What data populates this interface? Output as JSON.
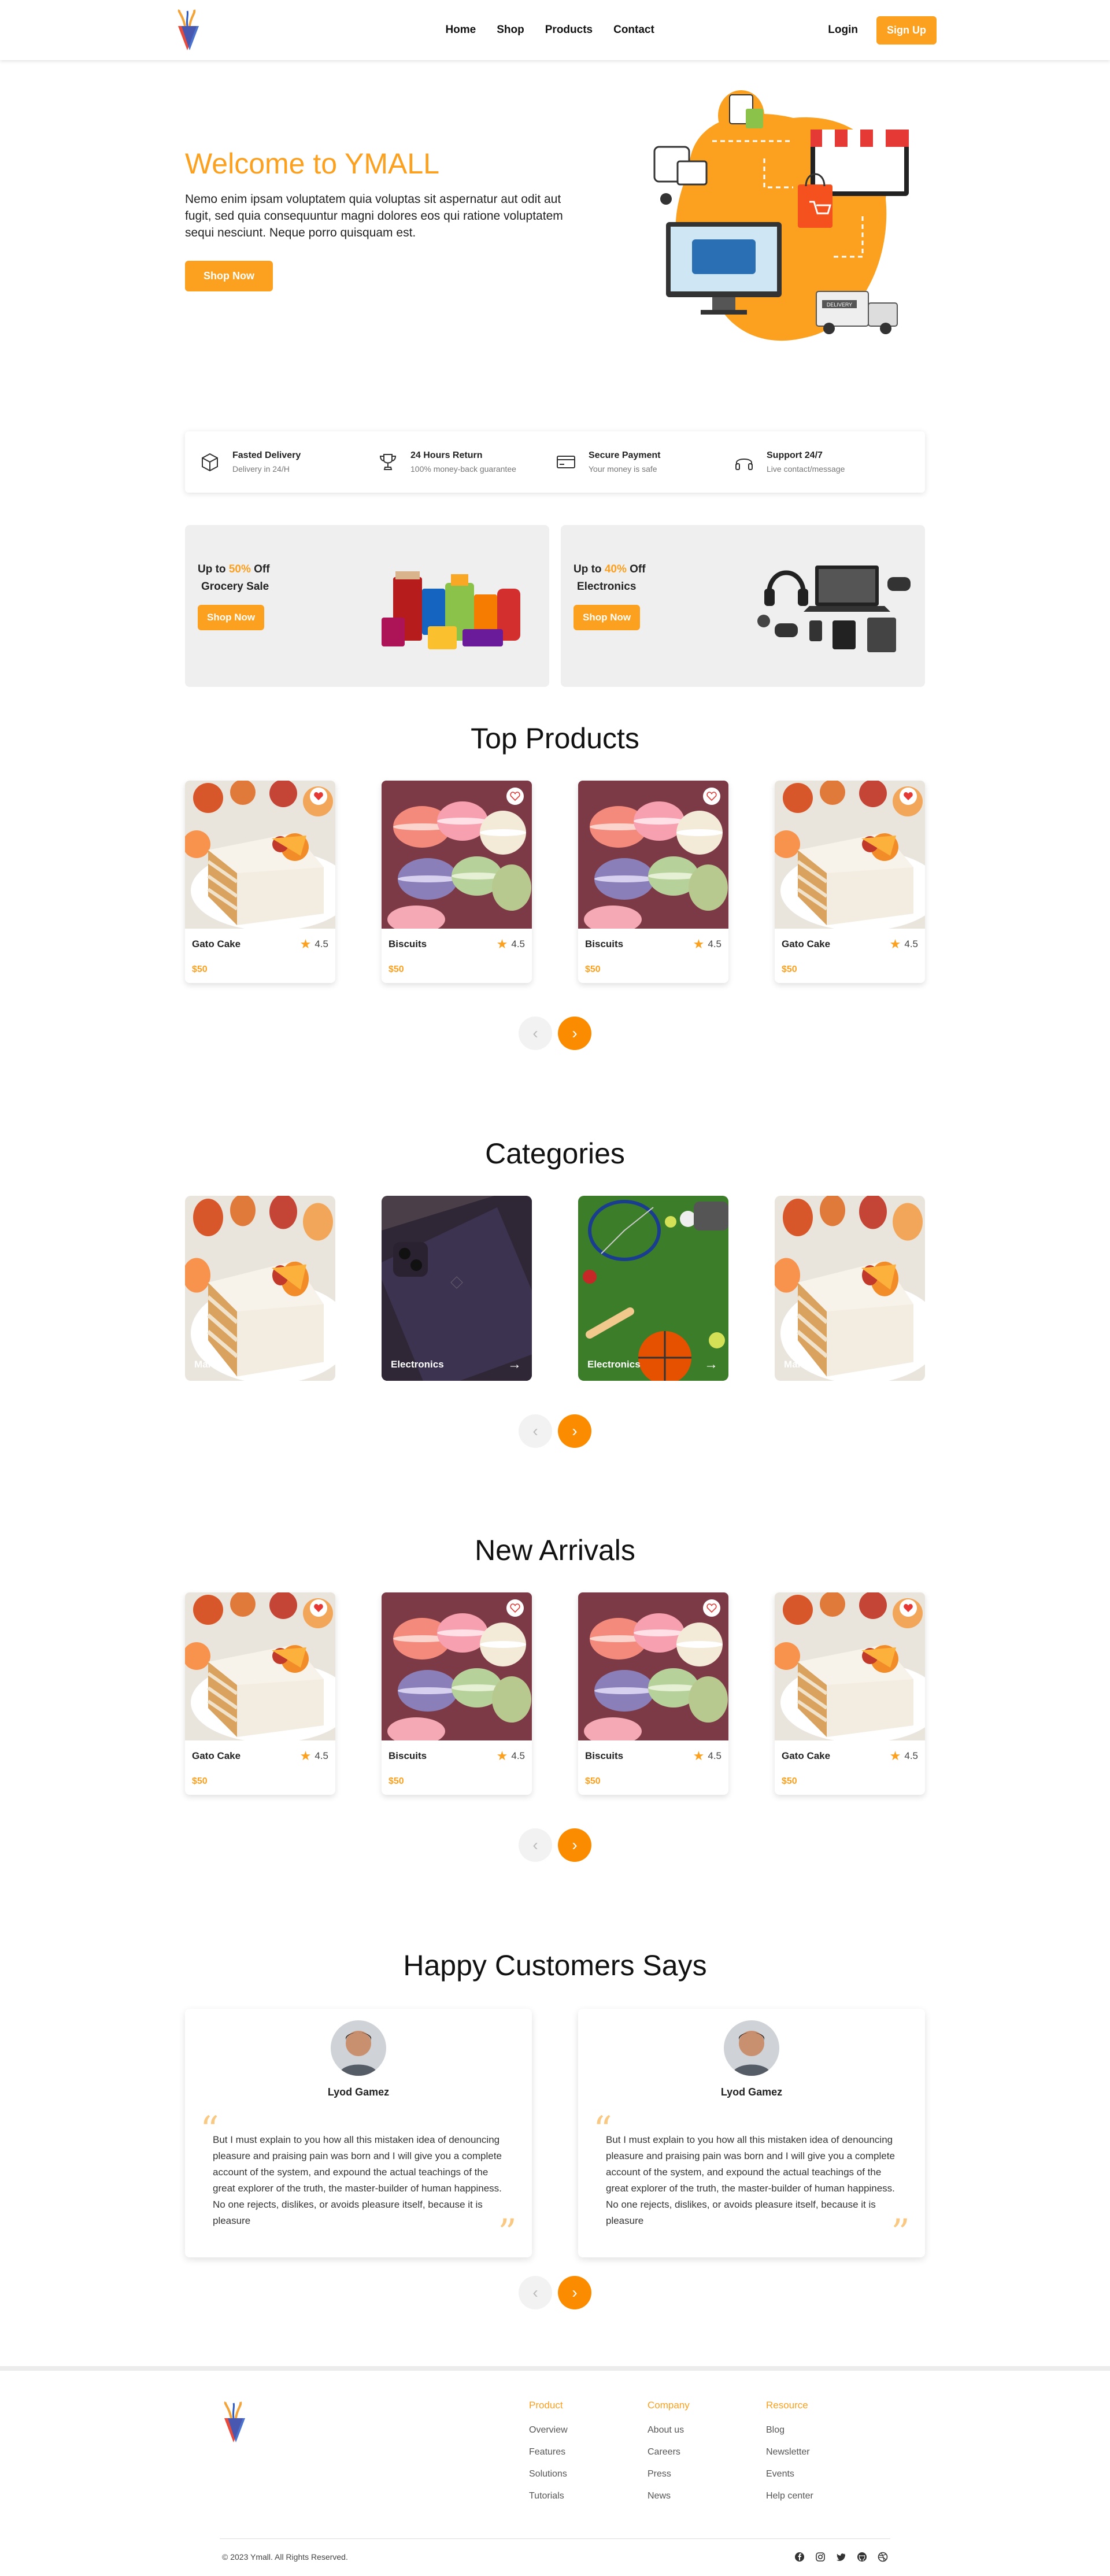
{
  "nav": {
    "links": [
      "Home",
      "Shop",
      "Products",
      "Contact"
    ],
    "login": "Login",
    "signup": "Sign Up"
  },
  "hero": {
    "title": "Welcome to YMALL",
    "description": "Nemo enim ipsam voluptatem quia voluptas sit aspernatur aut odit aut fugit, sed quia consequuntur magni dolores eos qui ratione voluptatem sequi nesciunt. Neque porro quisquam est.",
    "cta": "Shop Now",
    "truck_label": "DELIVERY"
  },
  "features": [
    {
      "title": "Fasted Delivery",
      "sub": "Delivery in 24/H",
      "icon": "box-icon"
    },
    {
      "title": "24 Hours Return",
      "sub": "100% money-back guarantee",
      "icon": "trophy-icon"
    },
    {
      "title": "Secure Payment",
      "sub": "Your money is safe",
      "icon": "credit-card-icon"
    },
    {
      "title": "Support 24/7",
      "sub": "Live contact/message",
      "icon": "headphones-icon"
    }
  ],
  "promos": [
    {
      "prefix": "Up to ",
      "percent": "50%",
      "suffix": " Off",
      "category": "Grocery Sale",
      "cta": "Shop Now"
    },
    {
      "prefix": "Up to ",
      "percent": "40%",
      "suffix": " Off",
      "category": "Electronics",
      "cta": "Shop Now"
    }
  ],
  "top_products": {
    "title": "Top Products",
    "items": [
      {
        "name": "Gato Cake",
        "rating": "4.5",
        "price": "$50",
        "image": "cake",
        "favorited": true
      },
      {
        "name": "Biscuits",
        "rating": "4.5",
        "price": "$50",
        "image": "macarons",
        "favorited": false
      },
      {
        "name": "Biscuits",
        "rating": "4.5",
        "price": "$50",
        "image": "macarons",
        "favorited": false
      },
      {
        "name": "Gato Cake",
        "rating": "4.5",
        "price": "$50",
        "image": "cake",
        "favorited": true
      }
    ]
  },
  "categories": {
    "title": "Categories",
    "items": [
      {
        "label": "Mart",
        "image": "cake"
      },
      {
        "label": "Electronics",
        "image": "phone"
      },
      {
        "label": "Electronics",
        "image": "sports"
      },
      {
        "label": "Mart",
        "image": "cake"
      }
    ]
  },
  "new_arrivals": {
    "title": "New Arrivals",
    "items": [
      {
        "name": "Gato Cake",
        "rating": "4.5",
        "price": "$50",
        "image": "cake",
        "favorited": true
      },
      {
        "name": "Biscuits",
        "rating": "4.5",
        "price": "$50",
        "image": "macarons",
        "favorited": false
      },
      {
        "name": "Biscuits",
        "rating": "4.5",
        "price": "$50",
        "image": "macarons",
        "favorited": false
      },
      {
        "name": "Gato Cake",
        "rating": "4.5",
        "price": "$50",
        "image": "cake",
        "favorited": true
      }
    ]
  },
  "reviews": {
    "title": "Happy Customers Says",
    "items": [
      {
        "name": "Lyod Gamez",
        "text": "But I must explain to you how all this mistaken idea of denouncing pleasure and praising pain was born and I will give you a complete account of the system, and expound the actual teachings of the great explorer of the truth, the master-builder of human happiness. No one rejects, dislikes, or avoids pleasure itself, because it is pleasure"
      },
      {
        "name": "Lyod Gamez",
        "text": "But I must explain to you how all this mistaken idea of denouncing pleasure and praising pain was born and I will give you a complete account of the system, and expound the actual teachings of the great explorer of the truth, the master-builder of human happiness. No one rejects, dislikes, or avoids pleasure itself, because it is pleasure"
      }
    ]
  },
  "pager": {
    "prev": "‹",
    "next": "›"
  },
  "footer": {
    "columns": [
      {
        "title": "Product",
        "links": [
          "Overview",
          "Features",
          "Solutions",
          "Tutorials"
        ]
      },
      {
        "title": "Company",
        "links": [
          "About us",
          "Careers",
          "Press",
          "News"
        ]
      },
      {
        "title": "Resource",
        "links": [
          "Blog",
          "Newsletter",
          "Events",
          "Help center"
        ]
      }
    ],
    "copyright": "© 2023 Ymall. All Rights Reserved.",
    "socials": [
      "facebook-icon",
      "instagram-icon",
      "twitter-icon",
      "github-icon",
      "dribbble-icon"
    ]
  },
  "colors": {
    "accent": "#fba01f",
    "accent_dark": "#fb8c00",
    "promo_bg": "#efefef"
  }
}
